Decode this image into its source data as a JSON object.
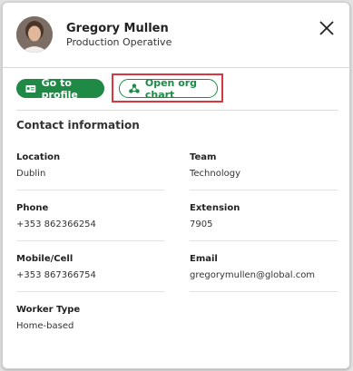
{
  "person": {
    "name": "Gregory Mullen",
    "title": "Production Operative"
  },
  "actions": {
    "go_to_profile": "Go to profile",
    "open_org_chart": "Open org chart"
  },
  "contact": {
    "section_title": "Contact information",
    "fields": [
      {
        "label": "Location",
        "value": "Dublin"
      },
      {
        "label": "Team",
        "value": "Technology"
      },
      {
        "label": "Phone",
        "value": "+353 862366254"
      },
      {
        "label": "Extension",
        "value": "7905"
      },
      {
        "label": "Mobile/Cell",
        "value": "+353 867366754"
      },
      {
        "label": "Email",
        "value": "gregorymullen@global.com"
      },
      {
        "label": "Worker Type",
        "value": "Home-based"
      }
    ]
  },
  "colors": {
    "accent": "#1e8a46",
    "highlight": "#d9363e"
  }
}
